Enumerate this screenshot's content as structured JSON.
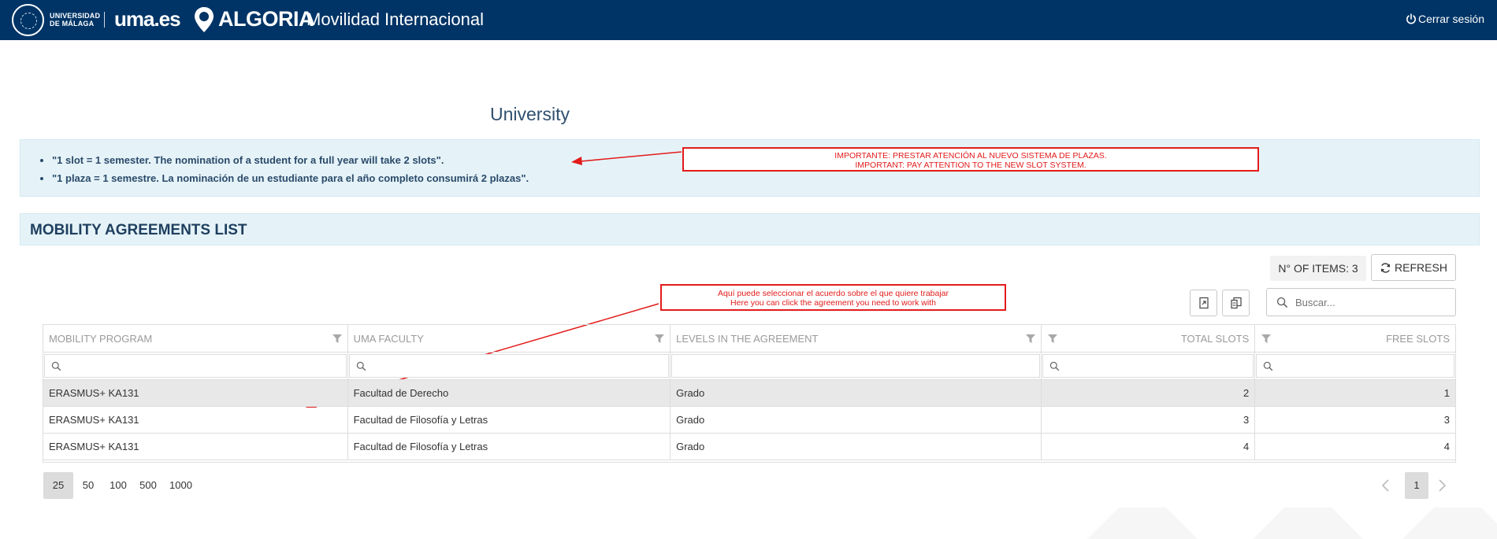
{
  "header": {
    "university_line1": "UNIVERSIDAD",
    "university_line2": "DE MÁLAGA",
    "brand": "uma.es",
    "algoria": "ALGORIA",
    "app_name": "Movilidad Internacional",
    "logout_label": "Cerrar sesión",
    "bg_color": "#003466"
  },
  "page": {
    "title": "University"
  },
  "info": {
    "notes": [
      "\"1 slot = 1 semester. The nomination of a student for a full year will take 2 slots\".",
      "\"1 plaza = 1 semestre. La nominación de un estudiante para el año completo consumirá 2 plazas\"."
    ]
  },
  "annotations": {
    "slots": {
      "line1": "IMPORTANTE: PRESTAR ATENCIÓN AL NUEVO SISTEMA DE PLAZAS.",
      "line2": "IMPORTANT: PAY ATTENTION TO THE NEW SLOT SYSTEM."
    },
    "agreement": {
      "line1": "Aquí puede seleccionar el acuerdo sobre el que quiere trabajar",
      "line2": "Here you can click the agreement you need to work with"
    },
    "color": "#e31b1b"
  },
  "section": {
    "title": "MOBILITY AGREEMENTS LIST"
  },
  "toolbar": {
    "items_count_label": "N° OF ITEMS: 3",
    "refresh_label": "REFRESH",
    "search_placeholder": "Buscar..."
  },
  "table": {
    "columns": [
      "MOBILITY PROGRAM",
      "UMA FACULTY",
      "LEVELS IN THE AGREEMENT",
      "TOTAL SLOTS",
      "FREE SLOTS"
    ],
    "rows": [
      {
        "program": "ERASMUS+ KA131",
        "faculty": "Facultad de Derecho",
        "level": "Grado",
        "total": "2",
        "free": "1"
      },
      {
        "program": "ERASMUS+ KA131",
        "faculty": "Facultad de Filosofía y Letras",
        "level": "Grado",
        "total": "3",
        "free": "3"
      },
      {
        "program": "ERASMUS+ KA131",
        "faculty": "Facultad de Filosofía y Letras",
        "level": "Grado",
        "total": "4",
        "free": "4"
      }
    ]
  },
  "pagination": {
    "page_sizes": [
      "25",
      "50",
      "100",
      "500",
      "1000"
    ],
    "current_page": "1"
  }
}
